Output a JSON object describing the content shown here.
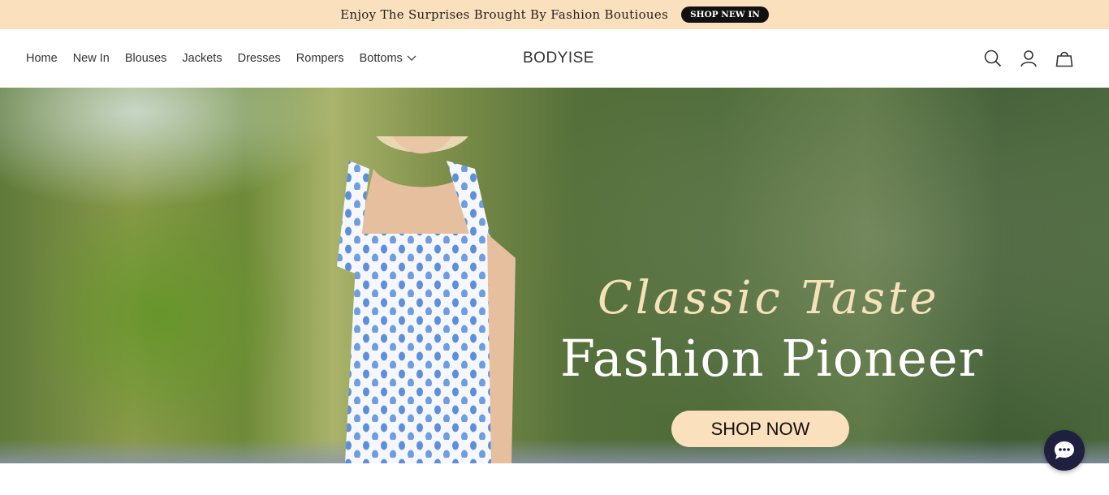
{
  "announcement": {
    "text": "Enjoy The Surprises Brought By Fashion Boutioues",
    "button_label": "SHOP NEW IN"
  },
  "header": {
    "logo": "BODYISE",
    "nav": [
      {
        "label": "Home"
      },
      {
        "label": "New In"
      },
      {
        "label": "Blouses"
      },
      {
        "label": "Jackets"
      },
      {
        "label": "Dresses"
      },
      {
        "label": "Rompers"
      },
      {
        "label": "Bottoms"
      }
    ],
    "icons": [
      "search-icon",
      "account-icon",
      "cart-icon"
    ]
  },
  "hero": {
    "script_title": "Classic Taste",
    "title": "Fashion Pioneer",
    "button_label": "SHOP NOW"
  },
  "chat": {
    "icon": "chat-icon"
  },
  "colors": {
    "announce_bg": "#fbe0bd",
    "button_dark": "#111111",
    "accent_cream": "#f6e2b9",
    "chat_bg": "#1f1f3f"
  }
}
